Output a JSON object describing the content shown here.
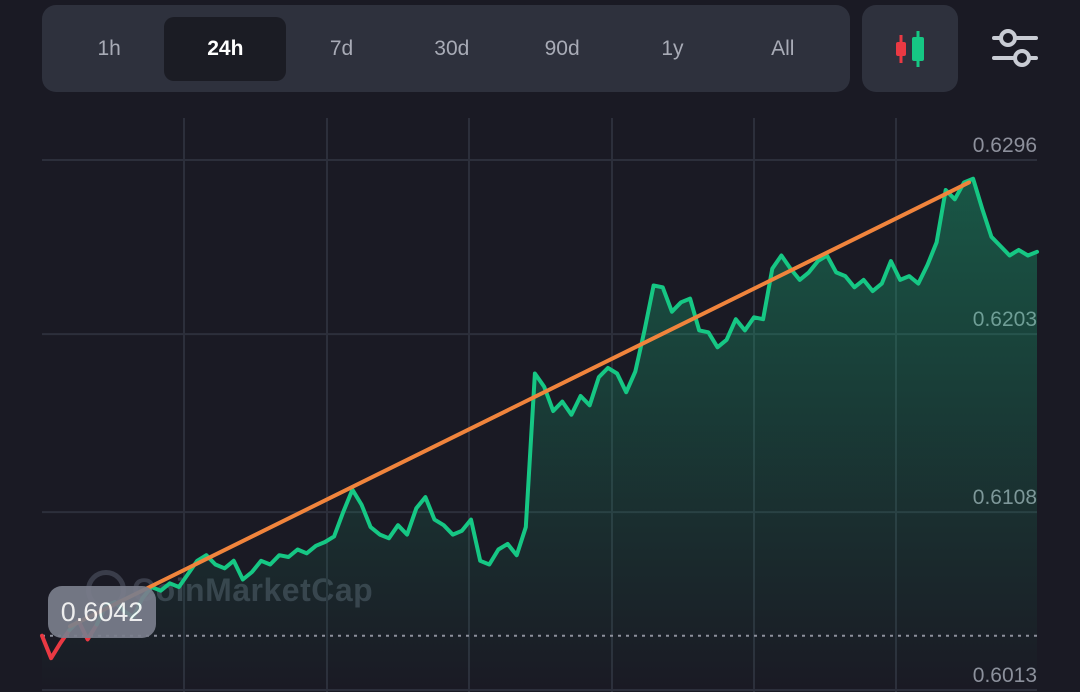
{
  "toolbar": {
    "tabs": [
      {
        "label": "1h"
      },
      {
        "label": "24h"
      },
      {
        "label": "7d"
      },
      {
        "label": "30d"
      },
      {
        "label": "90d"
      },
      {
        "label": "1y"
      },
      {
        "label": "All"
      }
    ],
    "active_tab": "24h",
    "candle_icon": "candlestick-icon",
    "settings_icon": "sliders-icon"
  },
  "watermark": "CoinMarketCap",
  "current_price_label": "0.6042",
  "colors": {
    "up": "#16c784",
    "down": "#ea3943",
    "trendline": "#f0843c",
    "background": "#1a1a24"
  },
  "chart_data": {
    "type": "line",
    "y_tick_labels": [
      "0.6296",
      "0.6203",
      "0.6108",
      "0.6013"
    ],
    "ylim": [
      0.6013,
      0.6296
    ],
    "grid": true,
    "reference_value": 0.6042,
    "series": [
      {
        "values": [
          0.6042,
          0.603,
          0.6038,
          0.6045,
          0.605,
          0.604,
          0.6048,
          0.6058,
          0.606,
          0.6055,
          0.6052,
          0.6062,
          0.6068,
          0.6066,
          0.607,
          0.6068,
          0.6075,
          0.6082,
          0.6085,
          0.608,
          0.6078,
          0.6082,
          0.6072,
          0.6076,
          0.6082,
          0.608,
          0.6085,
          0.6084,
          0.6088,
          0.6086,
          0.609,
          0.6092,
          0.6095,
          0.6108,
          0.612,
          0.6112,
          0.61,
          0.6096,
          0.6094,
          0.6101,
          0.6096,
          0.611,
          0.6116,
          0.6104,
          0.6101,
          0.6096,
          0.6098,
          0.6104,
          0.6082,
          0.608,
          0.6088,
          0.6091,
          0.6085,
          0.61,
          0.6182,
          0.6175,
          0.6162,
          0.6167,
          0.616,
          0.617,
          0.6165,
          0.618,
          0.6185,
          0.6182,
          0.6172,
          0.6183,
          0.6205,
          0.6229,
          0.6228,
          0.6215,
          0.622,
          0.6222,
          0.6205,
          0.6204,
          0.6196,
          0.62,
          0.6211,
          0.6205,
          0.6212,
          0.6211,
          0.6238,
          0.6245,
          0.6238,
          0.6232,
          0.6236,
          0.6242,
          0.6245,
          0.6236,
          0.6234,
          0.6228,
          0.6232,
          0.6226,
          0.623,
          0.6242,
          0.6232,
          0.6234,
          0.623,
          0.624,
          0.6252,
          0.628,
          0.6275,
          0.6284,
          0.6286,
          0.627,
          0.6255,
          0.625,
          0.6245,
          0.6248,
          0.6245,
          0.6247
        ]
      }
    ],
    "trendline": [
      0.6047,
      0.6284
    ]
  }
}
